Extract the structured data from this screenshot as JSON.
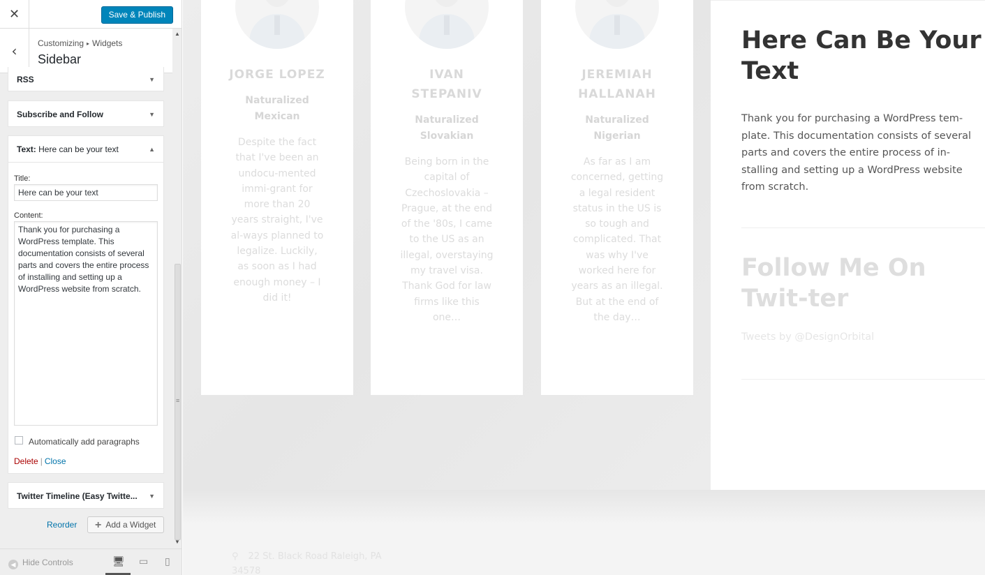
{
  "customizer": {
    "close_icon": "✕",
    "save_label": "Save & Publish",
    "back_icon": "‹",
    "breadcrumb": {
      "first": "Customizing",
      "sep": "▸",
      "second": "Widgets"
    },
    "section_title": "Sidebar",
    "widgets": {
      "rss": "RSS",
      "subscribe": "Subscribe and Follow",
      "text": {
        "type": "Text:",
        "name": "Here can be your text",
        "title_label": "Title:",
        "title_value": "Here can be your text",
        "content_label": "Content:",
        "content_value": "Thank you for purchasing a WordPress template. This documentation consists of several parts and covers the entire process of installing and setting up a WordPress website from scratch.",
        "autop_label": "Automatically add paragraphs",
        "delete_label": "Delete",
        "sep": "|",
        "close_label": "Close"
      },
      "twitter": "Twitter Timeline (Easy Twitte..."
    },
    "reorder_label": "Reorder",
    "add_widget_label": "Add a Widget",
    "hide_controls_label": "Hide Controls"
  },
  "preview": {
    "team": [
      {
        "name": "JORGE LOPEZ",
        "role": "Naturalized Mexican",
        "bio": "Despite the fact that I've been an undocu-mented immi-grant for more than 20 years straight, I've al-ways planned to legalize. Luckily, as soon as I had enough money – I did it!"
      },
      {
        "name": "IVAN STEPANIV",
        "role": "Naturalized Slovakian",
        "bio": "Being born in the capital of Czechoslovakia – Prague, at the end of the '80s, I came to the US as an illegal, overstaying my travel visa. Thank God for law firms like this one…"
      },
      {
        "name": "JEREMIAH HALLANAH",
        "role": "Naturalized Nigerian",
        "bio": "As far as I am concerned, getting a legal resident status in the US is so tough and complicated. That was why I've worked here for years as an illegal. But at the end of the day…"
      }
    ],
    "sidebar": {
      "text_title": "Here Can Be Your Text",
      "text_body": "Thank you for purchasing a WordPress tem-plate. This documentation consists of several parts and covers the entire process of in-stalling and setting up a WordPress website from scratch.",
      "twitter_title": "Follow Me On Twit-ter",
      "tweets_by": "Tweets by @DesignOrbital"
    },
    "footer": {
      "address": "22 St. Black Road Raleigh, PA 34578"
    }
  }
}
